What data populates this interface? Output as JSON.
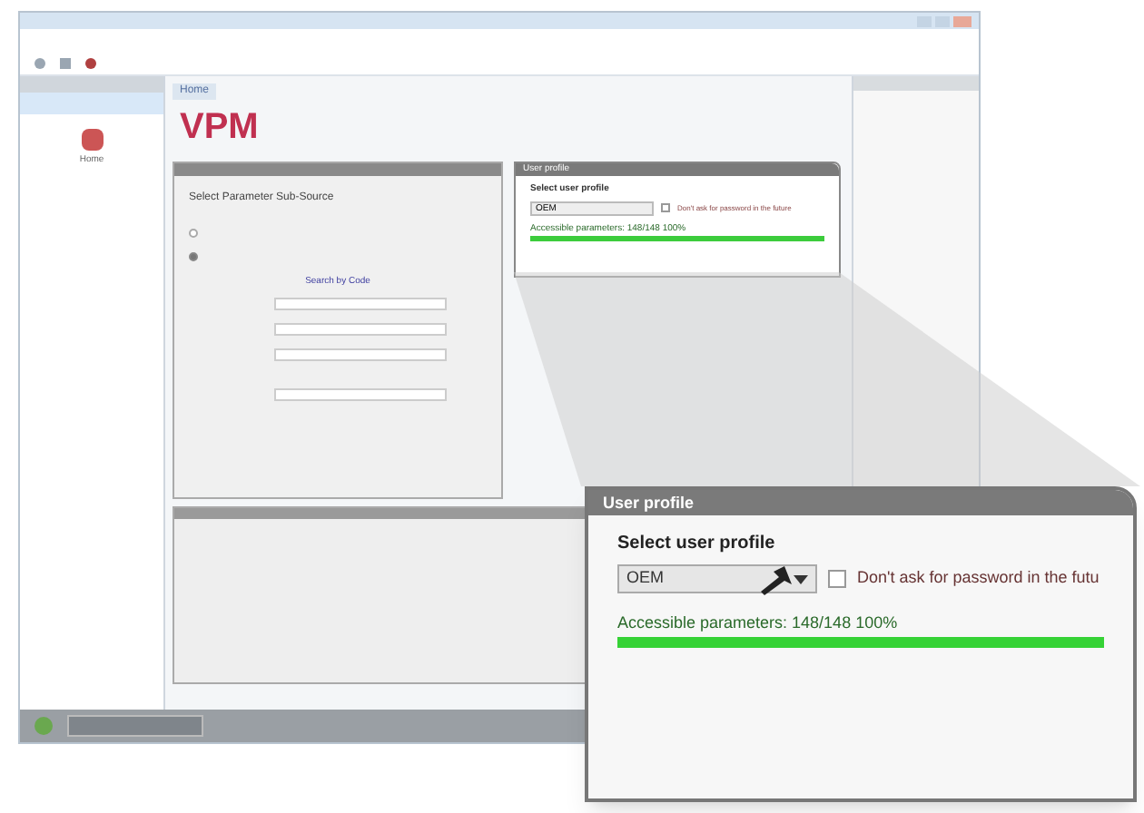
{
  "main": {
    "tab": "Home",
    "logo": "VPM",
    "source_panel": {
      "title": "Select Parameter Sub-Source",
      "options": [
        {
          "selected": false
        },
        {
          "selected": true
        }
      ],
      "section": "Search by Code"
    },
    "profile_panel": {
      "title": "User profile",
      "label": "Select user profile",
      "profile": "OEM",
      "remember": {
        "label": "Don't ask for password in the future",
        "checked": false
      },
      "reading": "Accessible parameters: 148/148 100%",
      "level": 1
    }
  },
  "sidebar": {
    "items": [
      {
        "label": "Home"
      }
    ]
  },
  "callout": {
    "title": "User profile",
    "label": "Select user profile",
    "profile": "OEM",
    "remember": {
      "label": "Don't ask for password in the futu",
      "checked": false
    },
    "reading": "Accessible parameters: 148/148 100%",
    "level": 1
  }
}
